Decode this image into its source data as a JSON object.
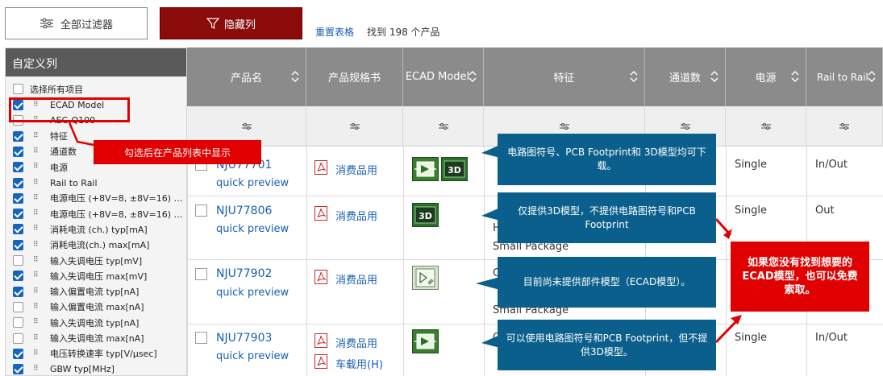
{
  "toolbar": {
    "filter_all_label": "全部过滤器",
    "hide_columns_label": "隐藏列",
    "reset_table_label": "重置表格",
    "result_count_text": "找到 198 个产品"
  },
  "panel": {
    "title": "自定义列",
    "select_all_label": "选择所有项目",
    "options": [
      {
        "label": "ECAD Model",
        "checked": true
      },
      {
        "label": "AEC-Q100",
        "checked": false
      },
      {
        "label": "特征",
        "checked": true
      },
      {
        "label": "通道数",
        "checked": true
      },
      {
        "label": "电源",
        "checked": true
      },
      {
        "label": "Rail to Rail",
        "checked": true
      },
      {
        "label": "电源电压 (+8V=8, ±8V=16) mi...",
        "checked": true
      },
      {
        "label": "电源电压 (+8V=8, ±8V=16) m...",
        "checked": true
      },
      {
        "label": "消耗电流 (ch.) typ[mA]",
        "checked": true
      },
      {
        "label": "消耗电流(ch.) max[mA]",
        "checked": true
      },
      {
        "label": "输入失调电压 typ[mV]",
        "checked": false
      },
      {
        "label": "输入失调电压 max[mV]",
        "checked": true
      },
      {
        "label": "输入偏置电流 typ[nA]",
        "checked": true
      },
      {
        "label": "输入偏置电流 max[nA]",
        "checked": false
      },
      {
        "label": "输入失调电流 typ[nA]",
        "checked": false
      },
      {
        "label": "输入失调电流 max[nA]",
        "checked": false
      },
      {
        "label": "电压转换速率 typ[V/μsec]",
        "checked": true
      },
      {
        "label": "GBW typ[MHz]",
        "checked": true
      }
    ]
  },
  "table": {
    "headers": [
      "产品名",
      "产品规格书",
      "ECAD Model",
      "特征",
      "通道数",
      "电源",
      "Rail to Rail"
    ],
    "rows": [
      {
        "name": "NJU77701",
        "quick_preview": "quick preview",
        "docs": [
          "消费品用"
        ],
        "ecad": "symbol+3d",
        "power": "Single",
        "rail": "In/Out",
        "feature_lines": []
      },
      {
        "name": "NJU77806",
        "quick_preview": "quick preview",
        "docs": [
          "消费品用"
        ],
        "ecad": "3d",
        "power": "Single",
        "rail": "Out",
        "feature_lines": [
          "H",
          "Small Package"
        ]
      },
      {
        "name": "NJU77902",
        "quick_preview": "quick preview",
        "docs": [
          "消费品用"
        ],
        "ecad": "request",
        "power": "",
        "rail": "",
        "feature_lines": [
          "C",
          "Small Package"
        ]
      },
      {
        "name": "NJU77903",
        "quick_preview": "quick preview",
        "docs": [
          "消费品用",
          "车载用(H)"
        ],
        "ecad": "symbol",
        "power": "Single",
        "rail": "In/Out",
        "feature_lines": [
          "C"
        ]
      }
    ]
  },
  "annotations": {
    "checked_tip": "勾选后在产品列表中显示",
    "callout1": "电路图符号、PCB Footprint和 3D模型均可下载。",
    "callout2": "仅提供3D模型，不提供电路图符号和PCB Footprint",
    "callout3": "目前尚未提供部件模型（ECAD模型）。",
    "callout4": "可以使用电路图符号和PCB Footprint，但不提供3D模型。",
    "request_note": "如果您没有找到想要的ECAD模型，也可以免费索取。"
  },
  "colors": {
    "hide_button": "#8b0a0a",
    "header_bg": "#8b8b8b",
    "callout_bg": "#0b5f8c",
    "annotation_red": "#e10000",
    "link_blue": "#1a5fb4",
    "checkbox_blue": "#1565c0"
  }
}
